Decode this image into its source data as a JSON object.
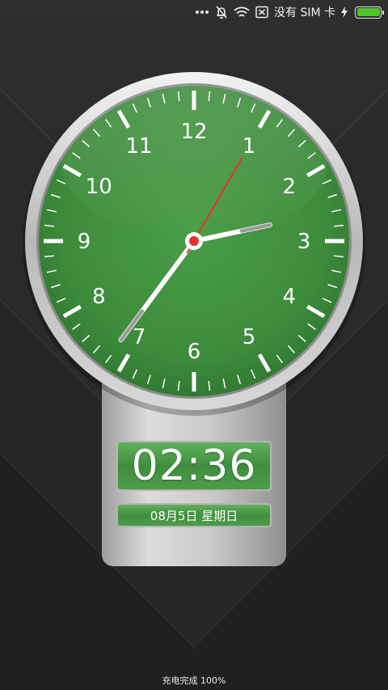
{
  "status_bar": {
    "icons": [
      "more-dots-icon",
      "notifications-muted-icon",
      "wifi-icon",
      "sim-x-icon",
      "charging-bolt-icon"
    ],
    "sim_text": "没有 SIM 卡",
    "battery_percent": 100,
    "battery_color": "#4fc32a"
  },
  "clock": {
    "numerals": [
      "12",
      "1",
      "2",
      "3",
      "4",
      "5",
      "6",
      "7",
      "8",
      "9",
      "10",
      "11"
    ],
    "hour": 2,
    "minute": 36,
    "second": 5,
    "face_color": "#3f8e40",
    "second_hand_color": "#e8302c"
  },
  "digital": {
    "time": "02:36",
    "date": "08月5日 星期日"
  },
  "footer": {
    "charging": "充电完成 100%"
  }
}
